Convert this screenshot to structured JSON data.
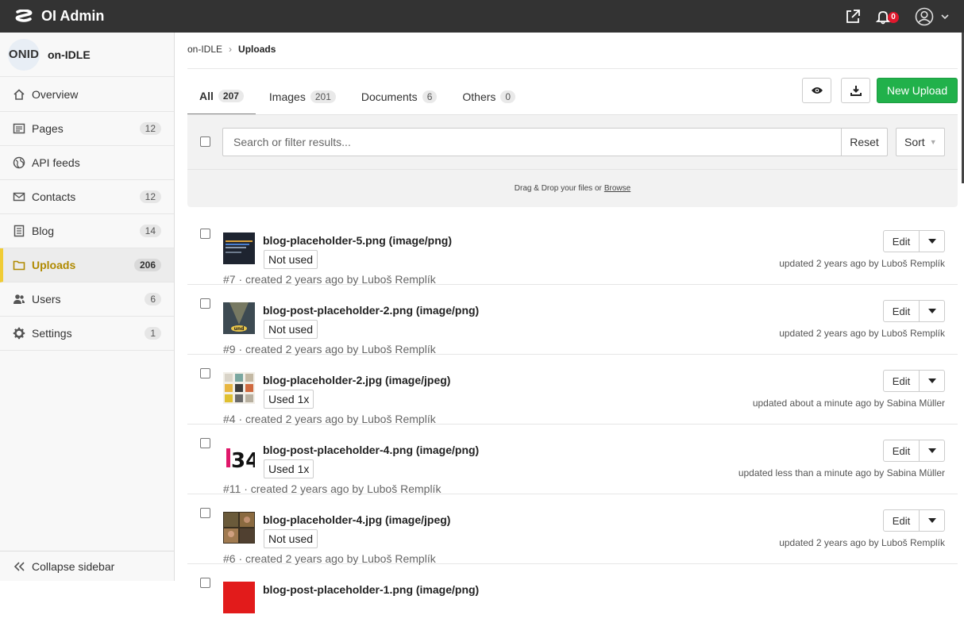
{
  "app": {
    "title": "OI Admin",
    "notifications": "0"
  },
  "sidebar": {
    "project_logo": "ONID",
    "project_name": "on-IDLE",
    "items": [
      {
        "label": "Overview",
        "count": "",
        "icon": "home-icon"
      },
      {
        "label": "Pages",
        "count": "12",
        "icon": "pages-icon"
      },
      {
        "label": "API feeds",
        "count": "",
        "icon": "globe-icon"
      },
      {
        "label": "Contacts",
        "count": "12",
        "icon": "envelope-icon"
      },
      {
        "label": "Blog",
        "count": "14",
        "icon": "blog-icon"
      },
      {
        "label": "Uploads",
        "count": "206",
        "icon": "folder-icon",
        "active": true
      },
      {
        "label": "Users",
        "count": "6",
        "icon": "users-icon"
      },
      {
        "label": "Settings",
        "count": "1",
        "icon": "gear-icon"
      }
    ],
    "collapse_label": "Collapse sidebar"
  },
  "breadcrumb": {
    "parent": "on-IDLE",
    "current": "Uploads"
  },
  "tabs": [
    {
      "label": "All",
      "count": "207",
      "active": true
    },
    {
      "label": "Images",
      "count": "201"
    },
    {
      "label": "Documents",
      "count": "6"
    },
    {
      "label": "Others",
      "count": "0"
    }
  ],
  "toolbar": {
    "new_upload": "New Upload"
  },
  "filter": {
    "placeholder": "Search or filter results...",
    "reset": "Reset",
    "sort": "Sort"
  },
  "dropzone": {
    "text": "Drag & Drop your files or",
    "browse": "Browse"
  },
  "uploads": [
    {
      "name": "blog-placeholder-5.png (image/png)",
      "tag": "Not used",
      "meta": "#7 · created 2 years ago by Luboš Remplík",
      "updated": "updated 2 years ago by Luboš Remplík",
      "edit": "Edit"
    },
    {
      "name": "blog-post-placeholder-2.png (image/png)",
      "tag": "Not used",
      "meta": "#9 · created 2 years ago by Luboš Remplík",
      "updated": "updated 2 years ago by Luboš Remplík",
      "edit": "Edit"
    },
    {
      "name": "blog-placeholder-2.jpg (image/jpeg)",
      "tag": "Used 1x",
      "meta": "#4 · created 2 years ago by Luboš Remplík",
      "updated": "updated about a minute ago by Sabina Müller",
      "edit": "Edit"
    },
    {
      "name": "blog-post-placeholder-4.png (image/png)",
      "tag": "Used 1x",
      "meta": "#11 · created 2 years ago by Luboš Remplík",
      "updated": "updated less than a minute ago by Sabina Müller",
      "edit": "Edit"
    },
    {
      "name": "blog-placeholder-4.jpg (image/jpeg)",
      "tag": "Not used",
      "meta": "#6 · created 2 years ago by Luboš Remplík",
      "updated": "updated 2 years ago by Luboš Remplík",
      "edit": "Edit"
    },
    {
      "name": "blog-post-placeholder-1.png (image/png)",
      "tag": "",
      "meta": "",
      "updated": "",
      "edit": ""
    }
  ],
  "colors": {
    "topbar": "#333333",
    "accent": "#21b14b",
    "active_nav": "#f0cc35",
    "badge": "#e0182d"
  }
}
